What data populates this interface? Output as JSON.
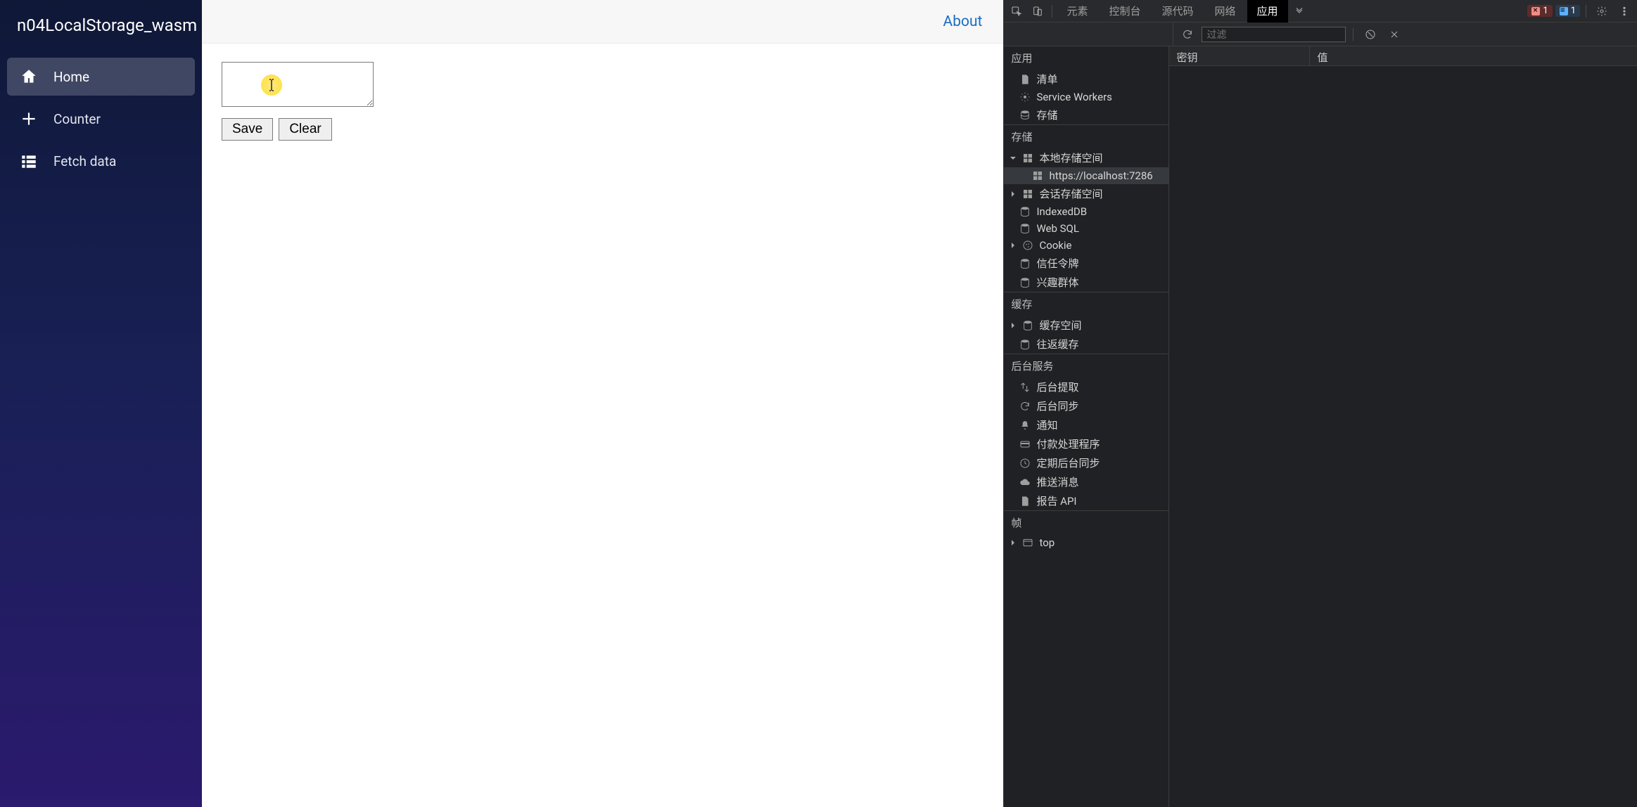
{
  "sidebar": {
    "brand": "n04LocalStorage_wasm",
    "items": [
      {
        "label": "Home",
        "icon": "home"
      },
      {
        "label": "Counter",
        "icon": "plus"
      },
      {
        "label": "Fetch data",
        "icon": "list"
      }
    ]
  },
  "topbar": {
    "about": "About"
  },
  "page": {
    "textarea_value": "",
    "save_label": "Save",
    "clear_label": "Clear"
  },
  "devtools": {
    "tabs": {
      "elements": "元素",
      "console": "控制台",
      "sources": "源代码",
      "network": "网络",
      "application": "应用"
    },
    "error_count": "1",
    "info_count": "1",
    "filter_placeholder": "过滤",
    "sections": {
      "application": "应用",
      "storage": "存储",
      "cache": "缓存",
      "bg_services": "后台服务",
      "frame": "帧"
    },
    "app_items": {
      "manifest": "清单",
      "service_workers": "Service Workers",
      "storage": "存储"
    },
    "storage_items": {
      "local_storage": "本地存储空间",
      "local_origin": "https://localhost:7286",
      "session_storage": "会话存储空间",
      "indexeddb": "IndexedDB",
      "websql": "Web SQL",
      "cookie": "Cookie",
      "trust_tokens": "信任令牌",
      "interest_groups": "兴趣群体"
    },
    "cache_items": {
      "cache_storage": "缓存空间",
      "bf_cache": "往返缓存"
    },
    "bg_items": {
      "bg_fetch": "后台提取",
      "bg_sync": "后台同步",
      "notifications": "通知",
      "payment_handler": "付款处理程序",
      "periodic_bg_sync": "定期后台同步",
      "push_messaging": "推送消息",
      "reporting_api": "报告 API"
    },
    "frame_items": {
      "top": "top"
    },
    "table": {
      "key_header": "密钥",
      "value_header": "值"
    }
  }
}
